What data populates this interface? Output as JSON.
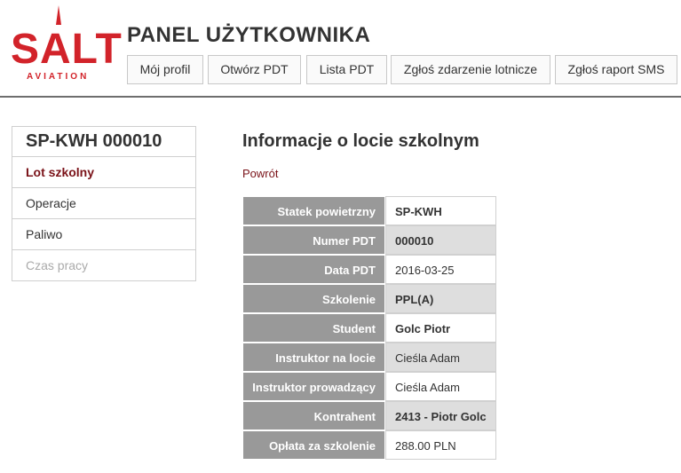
{
  "header": {
    "logo_text": "SALT",
    "logo_sub": "AVIATION",
    "title": "PANEL UŻYTKOWNIKA",
    "nav": [
      {
        "label": "Mój profil"
      },
      {
        "label": "Otwórz PDT"
      },
      {
        "label": "Lista PDT"
      },
      {
        "label": "Zgłoś zdarzenie lotnicze"
      },
      {
        "label": "Zgłoś raport SMS"
      }
    ]
  },
  "sidebar": {
    "title": "SP-KWH 000010",
    "items": [
      {
        "label": "Lot szkolny",
        "state": "active"
      },
      {
        "label": "Operacje",
        "state": "normal"
      },
      {
        "label": "Paliwo",
        "state": "normal"
      },
      {
        "label": "Czas pracy",
        "state": "disabled"
      }
    ]
  },
  "main": {
    "title": "Informacje o locie szkolnym",
    "back_label": "Powrót",
    "rows": [
      {
        "label": "Statek powietrzny",
        "value": "SP-KWH"
      },
      {
        "label": "Numer PDT",
        "value": "000010"
      },
      {
        "label": "Data PDT",
        "value": "2016-03-25"
      },
      {
        "label": "Szkolenie",
        "value": "PPL(A)"
      },
      {
        "label": "Student",
        "value": "Golc Piotr"
      },
      {
        "label": "Instruktor na locie",
        "value": "Cieśla Adam"
      },
      {
        "label": "Instruktor prowadzący",
        "value": "Cieśla Adam"
      },
      {
        "label": "Kontrahent",
        "value": "2413 - Piotr Golc"
      },
      {
        "label": "Opłata za szkolenie",
        "value": "288.00 PLN"
      }
    ]
  },
  "colors": {
    "brand_red": "#d2232a",
    "active_text": "#7a1218",
    "label_bg": "#999999"
  }
}
